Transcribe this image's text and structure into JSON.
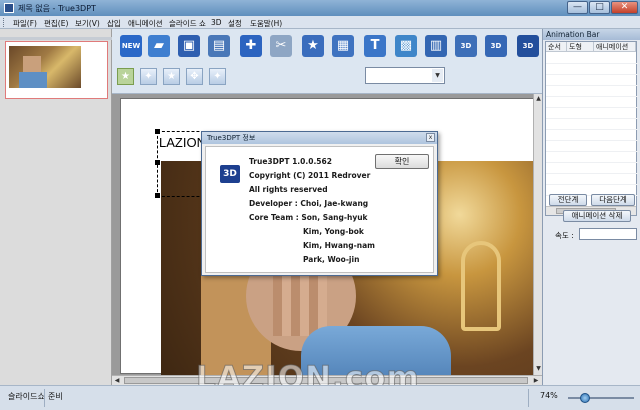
{
  "window": {
    "title": "제목 없음 - True3DPT",
    "minimize_glyph": "—",
    "maximize_glyph": "□",
    "close_glyph": "✕"
  },
  "menu": [
    "파일(F)",
    "편집(E)",
    "보기(V)",
    "삽입",
    "애니메이션",
    "슬라이드 쇼",
    "3D",
    "설정",
    "도움말(H)"
  ],
  "toolbar": {
    "main_buttons": [
      {
        "icon": "new-icon",
        "glyph": "NEW",
        "color": "#2a68c8"
      },
      {
        "icon": "open-folder-icon",
        "glyph": "▰",
        "color": "#3f7fd0"
      },
      {
        "icon": "save-icon",
        "glyph": "▣",
        "color": "#2f5fb0"
      },
      {
        "icon": "print-icon",
        "glyph": "▤",
        "color": "#4a78b8"
      },
      {
        "icon": "add-slide-icon",
        "glyph": "✚",
        "color": "#2c64c0"
      },
      {
        "icon": "cut-icon",
        "glyph": "✂",
        "color": "#8ea6c4"
      },
      {
        "icon": "add-star-slide-icon",
        "glyph": "★",
        "color": "#3a6dbd"
      },
      {
        "icon": "paste-icon",
        "glyph": "▦",
        "color": "#3f73c0"
      },
      {
        "icon": "text-icon",
        "glyph": "T",
        "color": "#3b76c8"
      },
      {
        "icon": "picture-icon",
        "glyph": "▩",
        "color": "#3f86c9"
      },
      {
        "icon": "video-icon",
        "glyph": "▥",
        "color": "#3366b2"
      },
      {
        "icon": "3d-object-icon",
        "glyph": "3D",
        "color": "#3d6fb8"
      },
      {
        "icon": "3d-video-icon",
        "glyph": "3D",
        "color": "#3567b5"
      },
      {
        "icon": "3d-mode-icon",
        "glyph": "3D",
        "color": "#234f9c"
      }
    ],
    "shape_buttons": [
      {
        "icon": "star-select-icon",
        "glyph": "★",
        "active": true
      },
      {
        "icon": "star-move-icon",
        "glyph": "✦"
      },
      {
        "icon": "star-scale-icon",
        "glyph": "★"
      },
      {
        "icon": "star-rotate-icon",
        "glyph": "✥"
      },
      {
        "icon": "star-transform-icon",
        "glyph": "✦"
      }
    ],
    "combo_value": "",
    "combo_arrow": "▼"
  },
  "slide": {
    "text": "LAZION"
  },
  "watermark": "LAZION.com",
  "scroll": {
    "left": "◀",
    "right": "▶",
    "up": "▲",
    "down": "▼"
  },
  "animation_bar": {
    "title": "Animation Bar",
    "columns": [
      "순서",
      "도형",
      "애니메이션"
    ],
    "prev_button": "전단계",
    "next_button": "다음단계",
    "delete_button": "애니메이션 삭제",
    "speed_label": "속도 :",
    "speed_value": ""
  },
  "status": {
    "slideshow": "슬라이드쇼",
    "state": "준비",
    "zoom": "74%"
  },
  "about_dialog": {
    "title": "True3DPT 정보",
    "close_glyph": "x",
    "logo_text": "3D",
    "ok_button": "확인",
    "lines": [
      "True3DPT 1.0.0.562",
      "Copyright (C) 2011 Redrover",
      "All rights reserved",
      "Developer   :   Choi, Jae-kwang",
      "Core Team   :   Son, Sang-hyuk",
      "Kim, Yong-bok",
      "Kim, Hwang-nam",
      "Park, Woo-jin"
    ]
  }
}
